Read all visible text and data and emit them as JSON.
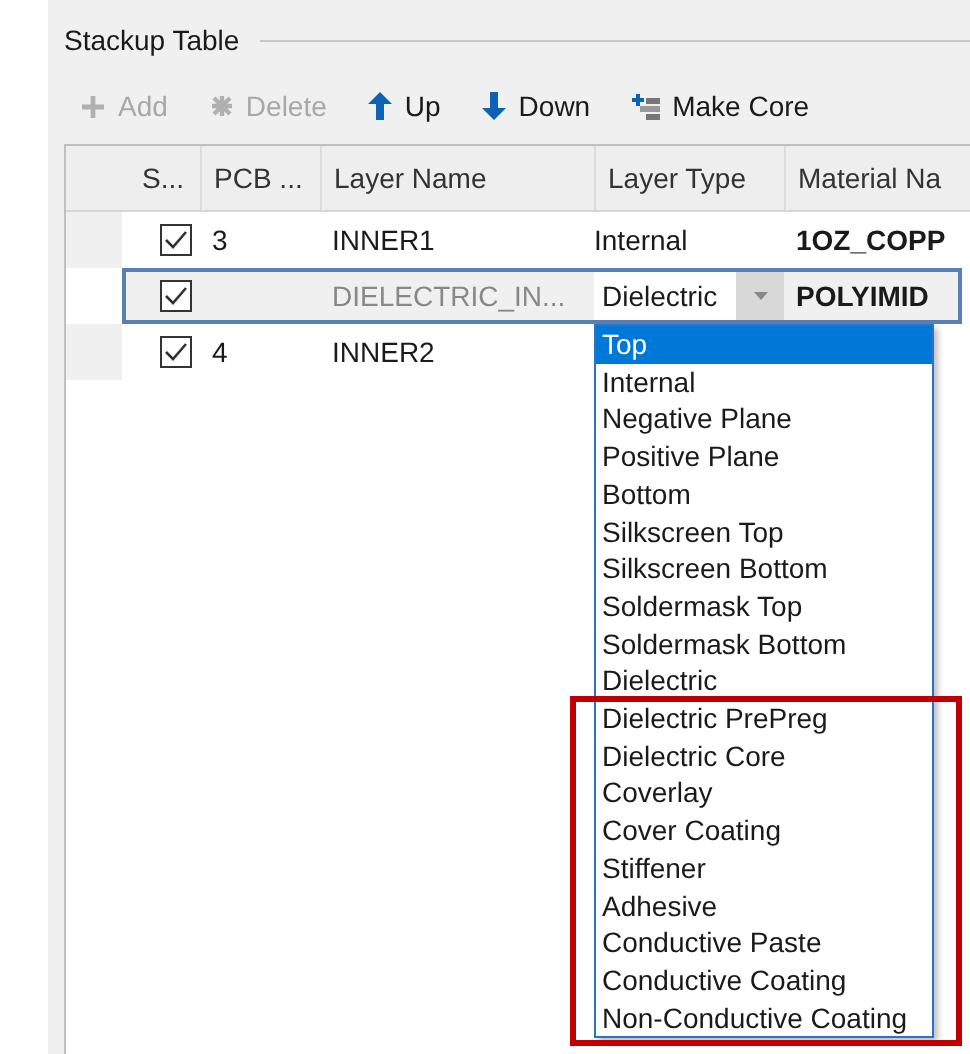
{
  "group": {
    "title": "Stackup Table"
  },
  "toolbar": [
    {
      "label": "Add",
      "kind": "plus",
      "disabled": true
    },
    {
      "label": "Delete",
      "kind": "cross",
      "disabled": true
    },
    {
      "label": "Up",
      "kind": "up",
      "disabled": false
    },
    {
      "label": "Down",
      "kind": "down",
      "disabled": false
    },
    {
      "label": "Make Core",
      "kind": "core",
      "disabled": false
    }
  ],
  "table": {
    "columns": [
      "S...",
      "PCB ...",
      "Layer Name",
      "Layer Type",
      "Material Na"
    ],
    "rows": [
      {
        "checked": true,
        "selected": false,
        "pcb": "3",
        "layer_name": "INNER1",
        "layer_type": "Internal",
        "material": "1OZ_COPP",
        "editing": false
      },
      {
        "checked": true,
        "selected": true,
        "pcb": "",
        "layer_name": "DIELECTRIC_IN...",
        "layer_type": "Dielectric",
        "material": "POLYIMID",
        "editing": true
      },
      {
        "checked": true,
        "selected": false,
        "pcb": "4",
        "layer_name": "INNER2",
        "editing": false
      }
    ]
  },
  "dropdown": {
    "groups": [
      {
        "highlighted": false,
        "items": [
          {
            "label": "Top",
            "selected": true
          },
          {
            "label": "Internal",
            "selected": false
          },
          {
            "label": "Negative Plane",
            "selected": false
          },
          {
            "label": "Positive Plane",
            "selected": false
          },
          {
            "label": "Bottom",
            "selected": false
          },
          {
            "label": "Silkscreen Top",
            "selected": false
          },
          {
            "label": "Silkscreen Bottom",
            "selected": false
          },
          {
            "label": "Soldermask Top",
            "selected": false
          },
          {
            "label": "Soldermask Bottom",
            "selected": false
          },
          {
            "label": "Dielectric",
            "selected": false
          }
        ]
      },
      {
        "highlighted": true,
        "items": [
          {
            "label": "Dielectric PrePreg",
            "selected": false
          },
          {
            "label": "Dielectric Core",
            "selected": false
          },
          {
            "label": "Coverlay",
            "selected": false
          },
          {
            "label": "Cover Coating",
            "selected": false
          },
          {
            "label": "Stiffener",
            "selected": false
          },
          {
            "label": "Adhesive",
            "selected": false
          },
          {
            "label": "Conductive Paste",
            "selected": false
          },
          {
            "label": "Conductive Coating",
            "selected": false
          },
          {
            "label": "Non-Conductive Coating",
            "selected": false
          }
        ]
      }
    ]
  }
}
